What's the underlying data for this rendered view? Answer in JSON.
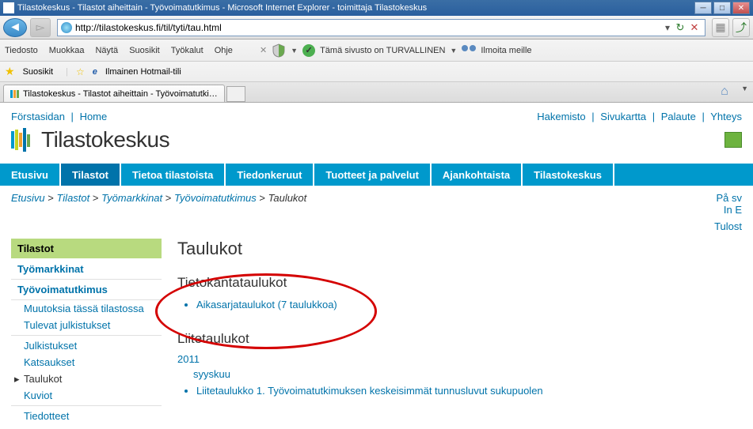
{
  "window": {
    "title": "Tilastokeskus - Tilastot aiheittain - Työvoimatutkimus - Microsoft Internet Explorer - toimittaja Tilastokeskus"
  },
  "url": "http://tilastokeskus.fi/til/tyti/tau.html",
  "menu": {
    "file": "Tiedosto",
    "edit": "Muokkaa",
    "view": "Näytä",
    "fav": "Suosikit",
    "tools": "Työkalut",
    "help": "Ohje",
    "safe": "Tämä sivusto on TURVALLINEN",
    "report": "Ilmoita meille"
  },
  "favbar": {
    "fav": "Suosikit",
    "hotmail": "Ilmainen Hotmail-tili"
  },
  "tab": {
    "title": "Tilastokeskus - Tilastot aiheittain - Työvoimatutkimus"
  },
  "topnav": {
    "l1": "Förstasidan",
    "l2": "Home",
    "r1": "Hakemisto",
    "r2": "Sivukartta",
    "r3": "Palaute",
    "r4": "Yhteys"
  },
  "brand": "Tilastokeskus",
  "mainnav": {
    "t1": "Etusivu",
    "t2": "Tilastot",
    "t3": "Tietoa tilastoista",
    "t4": "Tiedonkeruut",
    "t5": "Tuotteet ja palvelut",
    "t6": "Ajankohtaista",
    "t7": "Tilastokeskus"
  },
  "crumb": {
    "c1": "Etusivu",
    "c2": "Tilastot",
    "c3": "Työmarkkinat",
    "c4": "Työvoimatutkimus",
    "c5": "Taulukot"
  },
  "lang": {
    "sv": "På sv",
    "en": "In E"
  },
  "print": "Tulost",
  "sidebar": {
    "hdr": "Tilastot",
    "i1": "Työmarkkinat",
    "i2": "Työvoimatutkimus",
    "s1": "Muutoksia tässä tilastossa",
    "s2": "Tulevat julkistukset",
    "s3": "Julkistukset",
    "s4": "Katsaukset",
    "s5": "Taulukot",
    "s6": "Kuviot",
    "s7": "Tiedotteet"
  },
  "content": {
    "h1": "Taulukot",
    "h2a": "Tietokantataulukot",
    "link1": "Aikasarjataulukot (7 taulukkoa)",
    "h2b": "Liitetaulukot",
    "year": "2011",
    "month": "syyskuu",
    "link2": "Liitetaulukko 1. Työvoimatutkimuksen keskeisimmät tunnusluvut sukupuolen"
  }
}
